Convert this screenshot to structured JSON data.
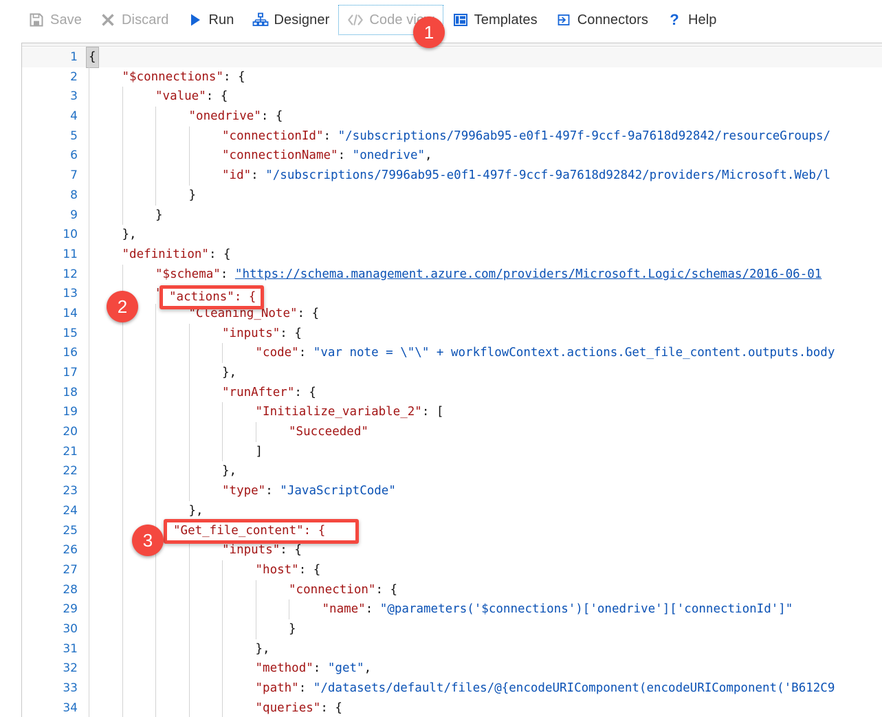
{
  "toolbar": {
    "items": [
      {
        "label": "Save",
        "icon": "save-icon",
        "state": "disabled"
      },
      {
        "label": "Discard",
        "icon": "discard-icon",
        "state": "disabled"
      },
      {
        "label": "Run",
        "icon": "run-icon",
        "state": "enabled"
      },
      {
        "label": "Designer",
        "icon": "designer-icon",
        "state": "enabled"
      },
      {
        "label": "Code view",
        "icon": "code-view-icon",
        "state": "active"
      },
      {
        "label": "Templates",
        "icon": "templates-icon",
        "state": "enabled"
      },
      {
        "label": "Connectors",
        "icon": "connectors-icon",
        "state": "enabled"
      },
      {
        "label": "Help",
        "icon": "help-icon",
        "state": "enabled"
      }
    ]
  },
  "colors": {
    "accent_blue": "#0b52b5",
    "key_red": "#a31515",
    "callout_red": "#f4483f",
    "toolbar_text": "#333333",
    "disabled_text": "#a6a6a6"
  },
  "callouts": [
    {
      "number": "1",
      "target": "code-view-toolbar-button"
    },
    {
      "number": "2",
      "target": "actions-key-line-13"
    },
    {
      "number": "3",
      "target": "get-file-content-key-line-25"
    }
  ],
  "highlights": [
    {
      "number": "2",
      "text": "\"actions\": {"
    },
    {
      "number": "3",
      "text": "\"Get_file_content\": {"
    }
  ],
  "editor": {
    "language": "json",
    "first_line": 1,
    "last_visible_line": 34,
    "lines": [
      {
        "n": "1",
        "indent": 0,
        "tokens": [
          {
            "t": "{",
            "c": "brk"
          }
        ]
      },
      {
        "n": "2",
        "indent": 1,
        "tokens": [
          {
            "t": "\"$connections\"",
            "c": "k"
          },
          {
            "t": ": {",
            "c": "p"
          }
        ]
      },
      {
        "n": "3",
        "indent": 2,
        "tokens": [
          {
            "t": "\"value\"",
            "c": "k"
          },
          {
            "t": ": {",
            "c": "p"
          }
        ]
      },
      {
        "n": "4",
        "indent": 3,
        "tokens": [
          {
            "t": "\"onedrive\"",
            "c": "k"
          },
          {
            "t": ": {",
            "c": "p"
          }
        ]
      },
      {
        "n": "5",
        "indent": 4,
        "tokens": [
          {
            "t": "\"connectionId\"",
            "c": "k"
          },
          {
            "t": ": ",
            "c": "p"
          },
          {
            "t": "\"/subscriptions/7996ab95-e0f1-497f-9ccf-9a7618d92842/resourceGroups/",
            "c": "s"
          }
        ]
      },
      {
        "n": "6",
        "indent": 4,
        "tokens": [
          {
            "t": "\"connectionName\"",
            "c": "k"
          },
          {
            "t": ": ",
            "c": "p"
          },
          {
            "t": "\"onedrive\"",
            "c": "s"
          },
          {
            "t": ",",
            "c": "p"
          }
        ]
      },
      {
        "n": "7",
        "indent": 4,
        "tokens": [
          {
            "t": "\"id\"",
            "c": "k"
          },
          {
            "t": ": ",
            "c": "p"
          },
          {
            "t": "\"/subscriptions/7996ab95-e0f1-497f-9ccf-9a7618d92842/providers/Microsoft.Web/l",
            "c": "s"
          }
        ]
      },
      {
        "n": "8",
        "indent": 3,
        "tokens": [
          {
            "t": "}",
            "c": "p"
          }
        ]
      },
      {
        "n": "9",
        "indent": 2,
        "tokens": [
          {
            "t": "}",
            "c": "p"
          }
        ]
      },
      {
        "n": "10",
        "indent": 1,
        "tokens": [
          {
            "t": "},",
            "c": "p"
          }
        ]
      },
      {
        "n": "11",
        "indent": 1,
        "tokens": [
          {
            "t": "\"definition\"",
            "c": "k"
          },
          {
            "t": ": {",
            "c": "p"
          }
        ]
      },
      {
        "n": "12",
        "indent": 2,
        "tokens": [
          {
            "t": "\"$schema\"",
            "c": "k"
          },
          {
            "t": ": ",
            "c": "p"
          },
          {
            "t": "\"https://schema.management.azure.com/providers/Microsoft.Logic/schemas/2016-06-01",
            "c": "lnk"
          }
        ]
      },
      {
        "n": "13",
        "indent": 2,
        "tokens": [
          {
            "t": "\"actions\"",
            "c": "k"
          },
          {
            "t": ": {",
            "c": "p"
          }
        ]
      },
      {
        "n": "14",
        "indent": 3,
        "tokens": [
          {
            "t": "\"Cleaning_Note\"",
            "c": "k"
          },
          {
            "t": ": {",
            "c": "p"
          }
        ]
      },
      {
        "n": "15",
        "indent": 4,
        "tokens": [
          {
            "t": "\"inputs\"",
            "c": "k"
          },
          {
            "t": ": {",
            "c": "p"
          }
        ]
      },
      {
        "n": "16",
        "indent": 5,
        "tokens": [
          {
            "t": "\"code\"",
            "c": "k"
          },
          {
            "t": ": ",
            "c": "p"
          },
          {
            "t": "\"var note = \\\"\\\" + workflowContext.actions.Get_file_content.outputs.body",
            "c": "s"
          }
        ]
      },
      {
        "n": "17",
        "indent": 4,
        "tokens": [
          {
            "t": "},",
            "c": "p"
          }
        ]
      },
      {
        "n": "18",
        "indent": 4,
        "tokens": [
          {
            "t": "\"runAfter\"",
            "c": "k"
          },
          {
            "t": ": {",
            "c": "p"
          }
        ]
      },
      {
        "n": "19",
        "indent": 5,
        "tokens": [
          {
            "t": "\"Initialize_variable_2\"",
            "c": "k"
          },
          {
            "t": ": [",
            "c": "p"
          }
        ]
      },
      {
        "n": "20",
        "indent": 6,
        "tokens": [
          {
            "t": "\"Succeeded\"",
            "c": "k"
          }
        ]
      },
      {
        "n": "21",
        "indent": 5,
        "tokens": [
          {
            "t": "]",
            "c": "p"
          }
        ]
      },
      {
        "n": "22",
        "indent": 4,
        "tokens": [
          {
            "t": "},",
            "c": "p"
          }
        ]
      },
      {
        "n": "23",
        "indent": 4,
        "tokens": [
          {
            "t": "\"type\"",
            "c": "k"
          },
          {
            "t": ": ",
            "c": "p"
          },
          {
            "t": "\"JavaScriptCode\"",
            "c": "s"
          }
        ]
      },
      {
        "n": "24",
        "indent": 3,
        "tokens": [
          {
            "t": "},",
            "c": "p"
          }
        ]
      },
      {
        "n": "25",
        "indent": 3,
        "tokens": [
          {
            "t": "\"Get_file_content\"",
            "c": "k"
          },
          {
            "t": ": {",
            "c": "p"
          }
        ]
      },
      {
        "n": "26",
        "indent": 4,
        "tokens": [
          {
            "t": "\"inputs\"",
            "c": "k"
          },
          {
            "t": ": {",
            "c": "p"
          }
        ]
      },
      {
        "n": "27",
        "indent": 5,
        "tokens": [
          {
            "t": "\"host\"",
            "c": "k"
          },
          {
            "t": ": {",
            "c": "p"
          }
        ]
      },
      {
        "n": "28",
        "indent": 6,
        "tokens": [
          {
            "t": "\"connection\"",
            "c": "k"
          },
          {
            "t": ": {",
            "c": "p"
          }
        ]
      },
      {
        "n": "29",
        "indent": 7,
        "tokens": [
          {
            "t": "\"name\"",
            "c": "k"
          },
          {
            "t": ": ",
            "c": "p"
          },
          {
            "t": "\"@parameters('$connections')['onedrive']['connectionId']\"",
            "c": "s"
          }
        ]
      },
      {
        "n": "30",
        "indent": 6,
        "tokens": [
          {
            "t": "}",
            "c": "p"
          }
        ]
      },
      {
        "n": "31",
        "indent": 5,
        "tokens": [
          {
            "t": "},",
            "c": "p"
          }
        ]
      },
      {
        "n": "32",
        "indent": 5,
        "tokens": [
          {
            "t": "\"method\"",
            "c": "k"
          },
          {
            "t": ": ",
            "c": "p"
          },
          {
            "t": "\"get\"",
            "c": "s"
          },
          {
            "t": ",",
            "c": "p"
          }
        ]
      },
      {
        "n": "33",
        "indent": 5,
        "tokens": [
          {
            "t": "\"path\"",
            "c": "k"
          },
          {
            "t": ": ",
            "c": "p"
          },
          {
            "t": "\"/datasets/default/files/@{encodeURIComponent(encodeURIComponent('B612C9",
            "c": "s"
          }
        ]
      },
      {
        "n": "34",
        "indent": 5,
        "tokens": [
          {
            "t": "\"queries\"",
            "c": "k"
          },
          {
            "t": ": {",
            "c": "p"
          }
        ]
      }
    ]
  }
}
